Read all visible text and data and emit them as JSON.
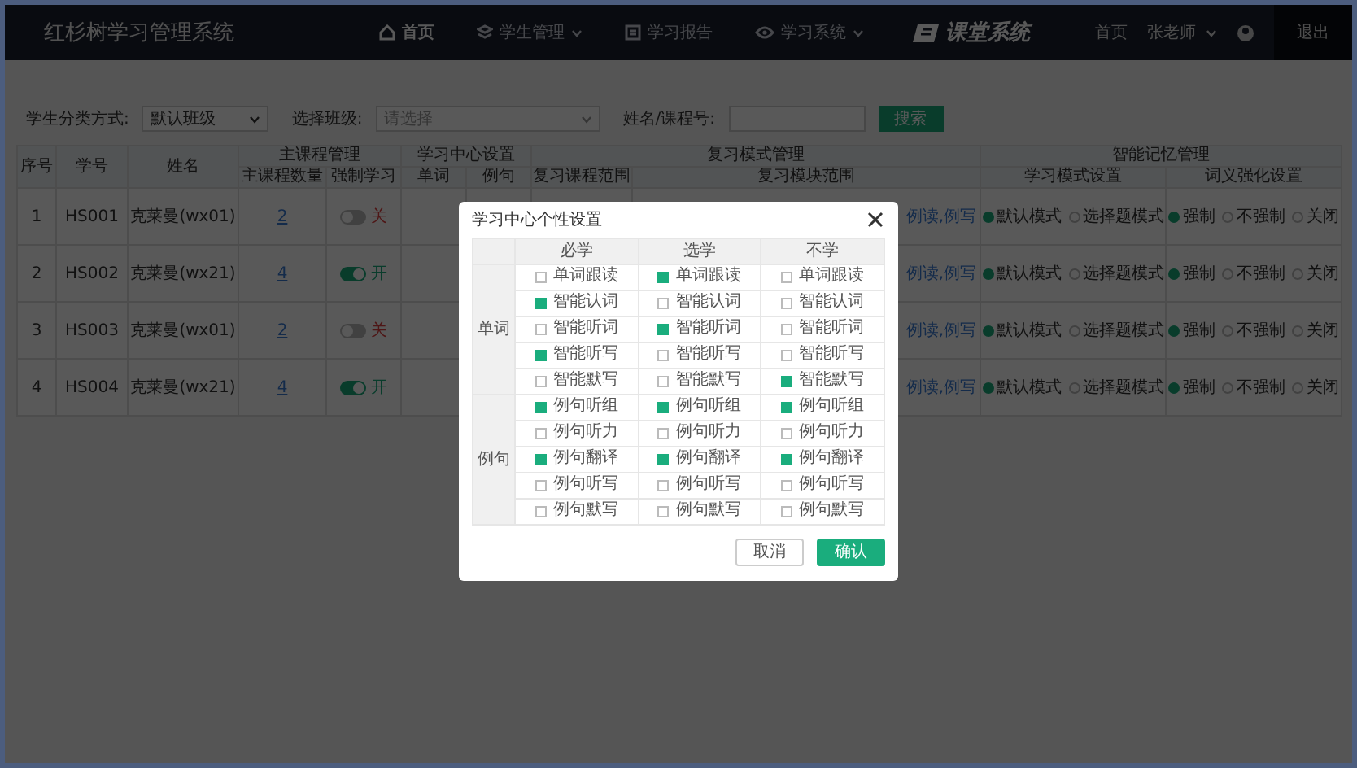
{
  "header": {
    "title": "红杉树学习管理系统",
    "nav": [
      {
        "label": "首页",
        "kind": "home",
        "dropdown": false,
        "selected": true
      },
      {
        "label": "学生管理",
        "kind": "layers",
        "dropdown": true,
        "selected": false
      },
      {
        "label": "学习报告",
        "kind": "report",
        "dropdown": false,
        "selected": false
      },
      {
        "label": "学习系统",
        "kind": "eye",
        "dropdown": true,
        "selected": false
      }
    ],
    "brand": "课堂系统",
    "home_link": "首页",
    "user": "张老师",
    "logout": "退出"
  },
  "filters": [
    {
      "kind": "select",
      "label": "学生分类方式:",
      "value": "默认班级"
    },
    {
      "kind": "select",
      "label": "选择班级:",
      "placeholder": "请选择"
    },
    {
      "kind": "input",
      "label": "姓名/课程号:"
    }
  ],
  "search_button": "搜索",
  "table": {
    "columns": [
      {
        "label": "序号"
      },
      {
        "label": "学号"
      },
      {
        "label": "姓名"
      },
      {
        "label": "主课程管理",
        "children": [
          {
            "label": "主课程数量"
          },
          {
            "label": "强制学习"
          }
        ]
      },
      {
        "label": "学习中心设置",
        "children": [
          {
            "label": "单词"
          },
          {
            "label": "例句"
          }
        ]
      },
      {
        "label": "复习模式管理",
        "children": [
          {
            "label": "复习课程范围"
          },
          {
            "label": "复习模块范围"
          }
        ]
      },
      {
        "label": "智能记忆管理",
        "children": [
          {
            "label": "学习模式设置"
          },
          {
            "label": "词义强化设置"
          }
        ]
      }
    ],
    "rows": [
      {
        "index": "1",
        "id": "HS001",
        "name": "克莱曼(wx01)",
        "course_count": "2",
        "forced": false,
        "forced_label": "关",
        "review_modules": "例读,例写",
        "study_mode": [
          {
            "label": "默认模式",
            "selected": true
          },
          {
            "label": "选择题模式",
            "selected": false
          }
        ],
        "reinforce": [
          {
            "label": "强制",
            "selected": true
          },
          {
            "label": "不强制",
            "selected": false
          },
          {
            "label": "关闭",
            "selected": false
          }
        ]
      },
      {
        "index": "2",
        "id": "HS002",
        "name": "克莱曼(wx21)",
        "course_count": "4",
        "forced": true,
        "forced_label": "开",
        "review_modules": "例读,例写",
        "study_mode": [
          {
            "label": "默认模式",
            "selected": true
          },
          {
            "label": "选择题模式",
            "selected": false
          }
        ],
        "reinforce": [
          {
            "label": "强制",
            "selected": true
          },
          {
            "label": "不强制",
            "selected": false
          },
          {
            "label": "关闭",
            "selected": false
          }
        ]
      },
      {
        "index": "3",
        "id": "HS003",
        "name": "克莱曼(wx01)",
        "course_count": "2",
        "forced": false,
        "forced_label": "关",
        "review_modules": "例读,例写",
        "study_mode": [
          {
            "label": "默认模式",
            "selected": true
          },
          {
            "label": "选择题模式",
            "selected": false
          }
        ],
        "reinforce": [
          {
            "label": "强制",
            "selected": true
          },
          {
            "label": "不强制",
            "selected": false
          },
          {
            "label": "关闭",
            "selected": false
          }
        ]
      },
      {
        "index": "4",
        "id": "HS004",
        "name": "克莱曼(wx21)",
        "course_count": "4",
        "forced": true,
        "forced_label": "开",
        "review_modules": "例读,例写",
        "study_mode": [
          {
            "label": "默认模式",
            "selected": true
          },
          {
            "label": "选择题模式",
            "selected": false
          }
        ],
        "reinforce": [
          {
            "label": "强制",
            "selected": true
          },
          {
            "label": "不强制",
            "selected": false
          },
          {
            "label": "关闭",
            "selected": false
          }
        ]
      }
    ]
  },
  "modal": {
    "title": "学习中心个性设置",
    "columns": [
      "必学",
      "选学",
      "不学"
    ],
    "groups": [
      {
        "label": "单词",
        "rows": [
          {
            "cells": [
              {
                "label": "单词跟读",
                "checked": false
              },
              {
                "label": "单词跟读",
                "checked": true
              },
              {
                "label": "单词跟读",
                "checked": false
              }
            ]
          },
          {
            "cells": [
              {
                "label": "智能认词",
                "checked": true
              },
              {
                "label": "智能认词",
                "checked": false
              },
              {
                "label": "智能认词",
                "checked": false
              }
            ]
          },
          {
            "cells": [
              {
                "label": "智能听词",
                "checked": false
              },
              {
                "label": "智能听词",
                "checked": true
              },
              {
                "label": "智能听词",
                "checked": false
              }
            ]
          },
          {
            "cells": [
              {
                "label": "智能听写",
                "checked": true
              },
              {
                "label": "智能听写",
                "checked": false
              },
              {
                "label": "智能听写",
                "checked": false
              }
            ]
          },
          {
            "cells": [
              {
                "label": "智能默写",
                "checked": false
              },
              {
                "label": "智能默写",
                "checked": false
              },
              {
                "label": "智能默写",
                "checked": true
              }
            ]
          }
        ]
      },
      {
        "label": "例句",
        "rows": [
          {
            "cells": [
              {
                "label": "例句听组",
                "checked": true
              },
              {
                "label": "例句听组",
                "checked": true
              },
              {
                "label": "例句听组",
                "checked": true
              }
            ]
          },
          {
            "cells": [
              {
                "label": "例句听力",
                "checked": false
              },
              {
                "label": "例句听力",
                "checked": false
              },
              {
                "label": "例句听力",
                "checked": false
              }
            ]
          },
          {
            "cells": [
              {
                "label": "例句翻译",
                "checked": true
              },
              {
                "label": "例句翻译",
                "checked": true
              },
              {
                "label": "例句翻译",
                "checked": true
              }
            ]
          },
          {
            "cells": [
              {
                "label": "例句听写",
                "checked": false
              },
              {
                "label": "例句听写",
                "checked": false
              },
              {
                "label": "例句听写",
                "checked": false
              }
            ]
          },
          {
            "cells": [
              {
                "label": "例句默写",
                "checked": false
              },
              {
                "label": "例句默写",
                "checked": false
              },
              {
                "label": "例句默写",
                "checked": false
              }
            ]
          }
        ]
      }
    ],
    "buttons": [
      {
        "label": "取消",
        "kind": "secondary"
      },
      {
        "label": "确认",
        "kind": "primary"
      }
    ]
  }
}
